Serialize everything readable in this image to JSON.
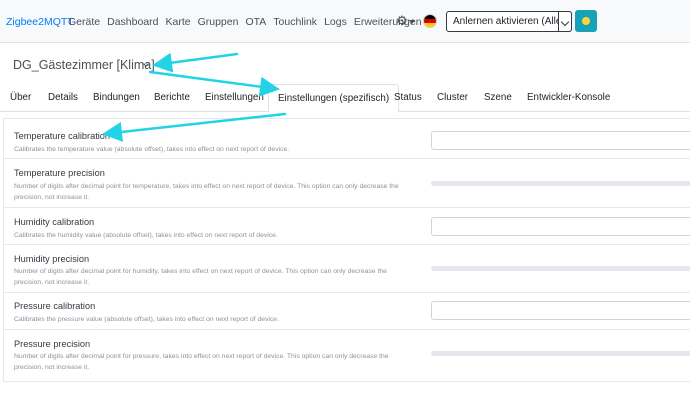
{
  "navbar": {
    "brand": "Zigbee2MQTT",
    "links": [
      "Geräte",
      "Dashboard",
      "Karte",
      "Gruppen",
      "OTA",
      "Touchlink",
      "Logs",
      "Erweiterungen"
    ],
    "settings_icon": "gear-icon",
    "language_flag": "germany-flag-icon",
    "permit_join_label": "Anlernen aktivieren (Alle)",
    "theme_icon": "sun-icon"
  },
  "device": {
    "name": "DG_Gästezimmer [Klima]"
  },
  "tabs": [
    "Über",
    "Details",
    "Bindungen",
    "Berichte",
    "Einstellungen",
    "Einstellungen (spezifisch)",
    "Status",
    "Cluster",
    "Szene",
    "Entwickler-Konsole"
  ],
  "active_tab": "Einstellungen (spezifisch)",
  "settings": [
    {
      "title": "Temperature calibration",
      "description": "Calibrates the temperature value (absolute offset), takes into effect on next report of device.",
      "control": "number-input"
    },
    {
      "title": "Temperature precision",
      "description": "Number of digits after decimal point for temperature, takes into effect on next report of device. This option can only decrease the precision, not increase it.",
      "control": "slider"
    },
    {
      "title": "Humidity calibration",
      "description": "Calibrates the humidity value (absolute offset), takes into effect on next report of device.",
      "control": "number-input"
    },
    {
      "title": "Humidity precision",
      "description": "Number of digits after decimal point for humidity, takes into effect on next report of device. This option can only decrease the precision, not increase it.",
      "control": "slider"
    },
    {
      "title": "Pressure calibration",
      "description": "Calibrates the pressure value (absolute offset), takes into effect on next report of device.",
      "control": "number-input"
    },
    {
      "title": "Pressure precision",
      "description": "Number of digits after decimal point for pressure, takes into effect on next report of device. This option can only decrease the precision, not increase it.",
      "control": "slider"
    }
  ],
  "colors": {
    "brand": "#007bff",
    "annotation_arrow": "#22d3e6",
    "theme_button": "#17a2b8"
  }
}
